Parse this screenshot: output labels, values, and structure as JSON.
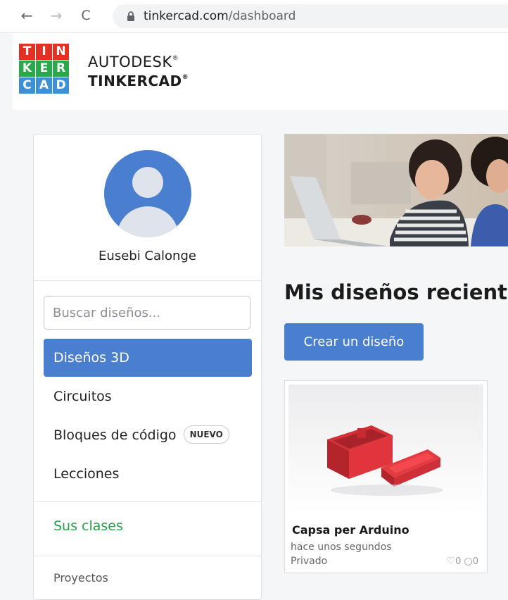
{
  "browser": {
    "url_host": "tinkercad.com",
    "url_path": "/dashboard",
    "back_icon": "←",
    "forward_icon": "→",
    "reload_icon": "C"
  },
  "header": {
    "logo_letters": [
      "T",
      "I",
      "N",
      "K",
      "E",
      "R",
      "C",
      "A",
      "D"
    ],
    "brand_line1": "AUTODESK",
    "brand_line2": "TINKERCAD",
    "reg_mark": "®"
  },
  "sidebar": {
    "user_name": "Eusebi Calonge",
    "search_placeholder": "Buscar diseños...",
    "nav": [
      {
        "label": "Diseños 3D",
        "active": true
      },
      {
        "label": "Circuitos"
      },
      {
        "label": "Bloques de código",
        "badge": "NUEVO"
      },
      {
        "label": "Lecciones"
      }
    ],
    "classes_link": "Sus clases",
    "projects_link": "Proyectos"
  },
  "main": {
    "recent_title": "Mis diseños recient",
    "create_button": "Crear un diseño",
    "card": {
      "title": "Capsa per Arduino",
      "time": "hace unos segundos",
      "privacy": "Privado",
      "likes": "0",
      "comments": "0",
      "like_icon": "♡",
      "comment_icon": "○"
    }
  },
  "colors": {
    "accent": "#4a7fd0",
    "classes_green": "#23a047",
    "logo_red": "#e42f25",
    "logo_green": "#2aa94a",
    "logo_blue": "#3d8fd6"
  }
}
